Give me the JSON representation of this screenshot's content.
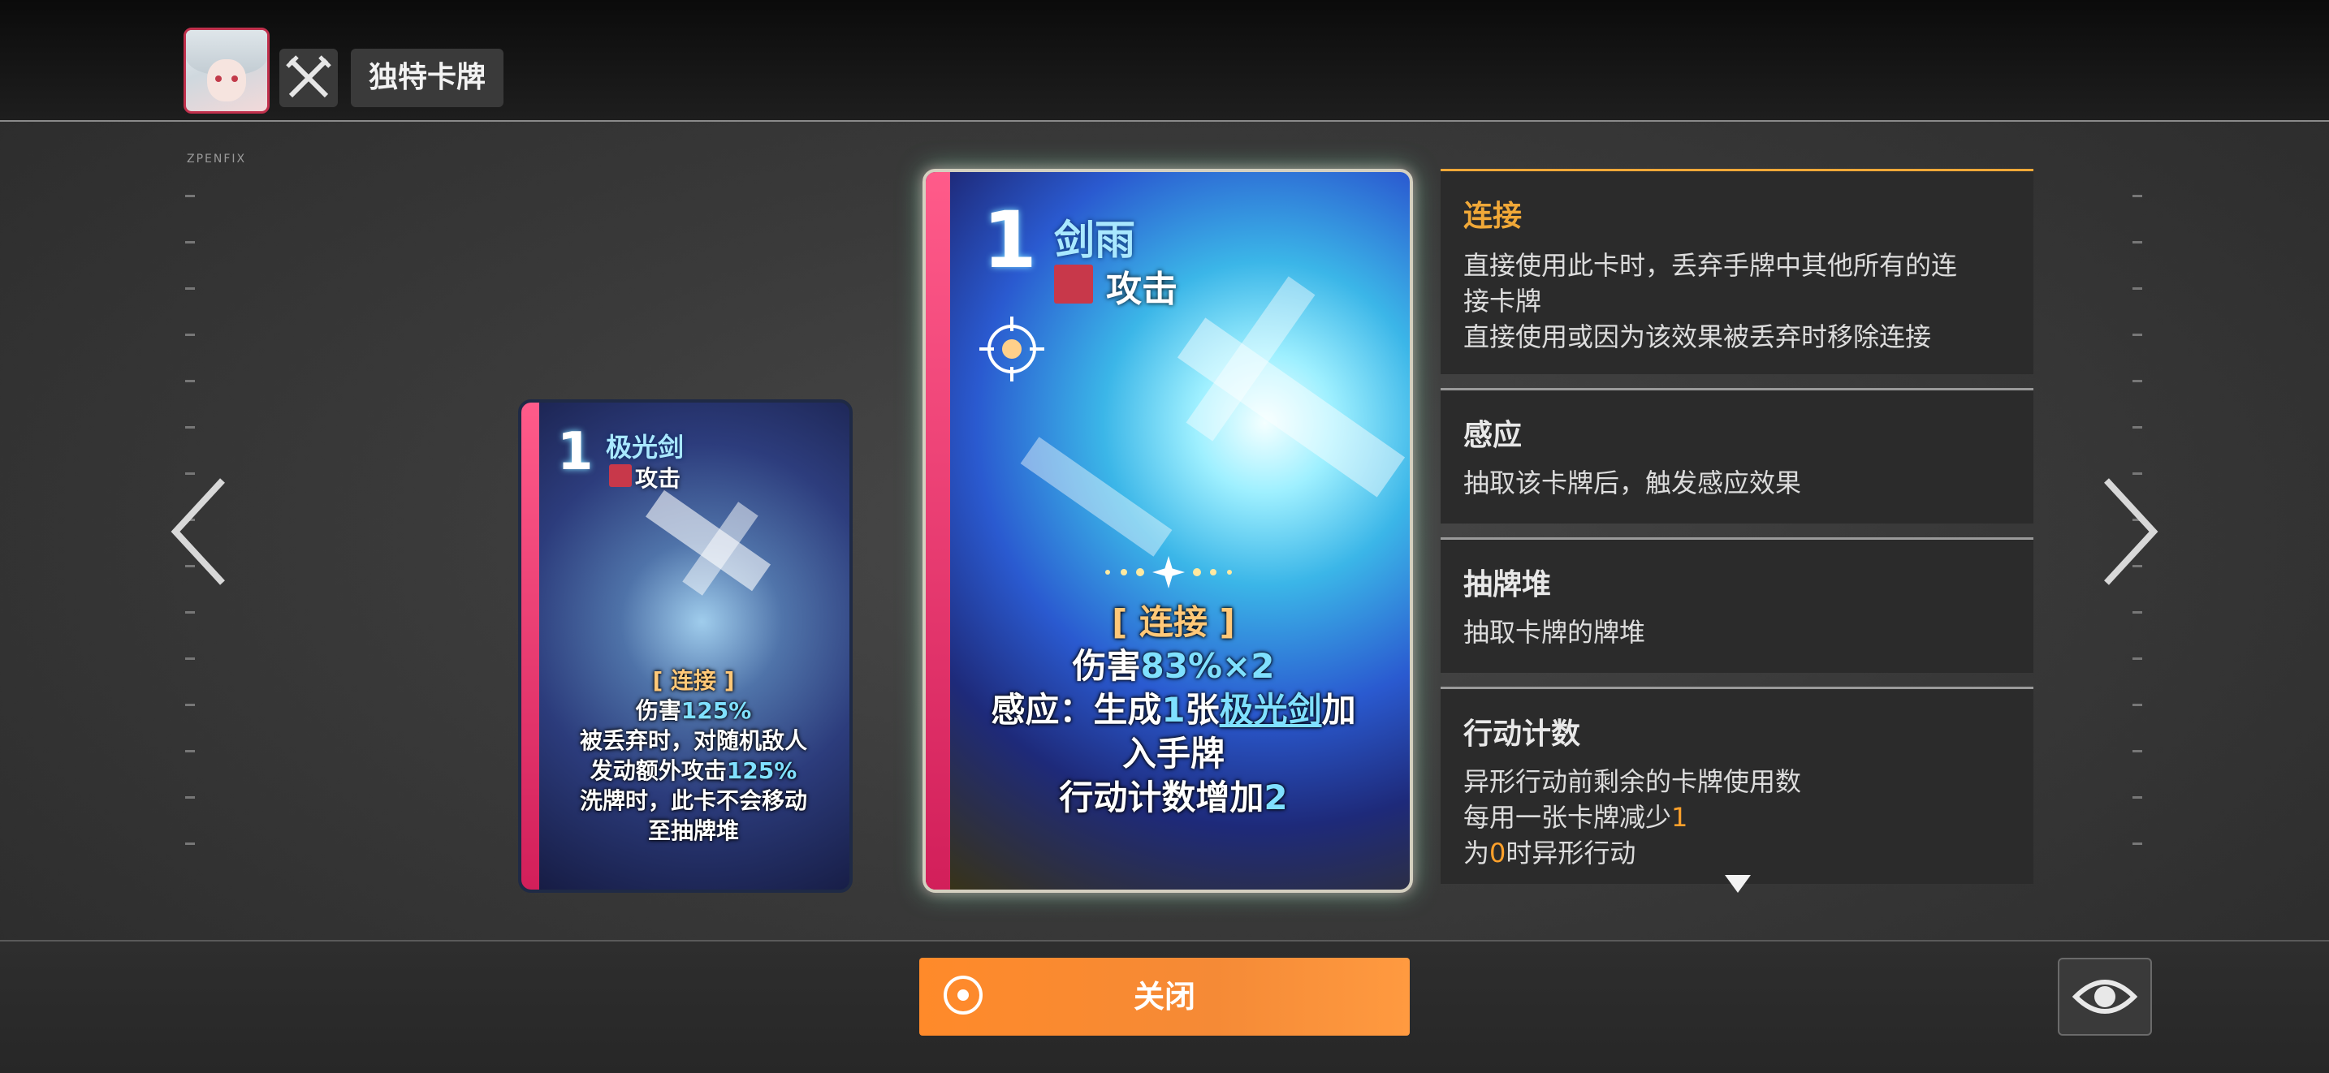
{
  "header": {
    "title": "独特卡牌",
    "avatar_icon": "character-portrait",
    "type_icon": "crossed-swords-icon",
    "tiny_label": "ZPENFIX"
  },
  "cards": {
    "small": {
      "cost": "1",
      "name": "极光剑",
      "type": "攻击",
      "tag": "[ 连接 ]",
      "line1_prefix": "伤害",
      "line1_value": "125%",
      "line2": "被丢弃时，对随机敌人",
      "line3_prefix": "发动额外攻击",
      "line3_value": "125%",
      "line4": "洗牌时，此卡不会移动",
      "line5": "至抽牌堆"
    },
    "main": {
      "cost": "1",
      "name": "剑雨",
      "type": "攻击",
      "tag": "[ 连接 ]",
      "line1_prefix": "伤害",
      "line1_value": "83%×2",
      "line2_prefix": "感应：生成",
      "line2_count": "1",
      "line2_mid": "张",
      "line2_link": "极光剑",
      "line2_suffix": "加",
      "line3": "入手牌",
      "line4_prefix": "行动计数增加",
      "line4_value": "2"
    }
  },
  "keywords": [
    {
      "title": "连接",
      "desc1": "直接使用此卡时，丢弃手牌中其他所有的连",
      "desc2": "接卡牌",
      "desc3": "直接使用或因为该效果被丢弃时移除连接"
    },
    {
      "title": "感应",
      "desc1": "抽取该卡牌后，触发感应效果"
    },
    {
      "title": "抽牌堆",
      "desc1": "抽取卡牌的牌堆"
    },
    {
      "title": "行动计数",
      "desc1": "异形行动前剩余的卡牌使用数",
      "desc2_prefix": "每用一张卡牌减少",
      "desc2_value": "1",
      "desc3_prefix": "为",
      "desc3_value": "0",
      "desc3_suffix": "时异形行动"
    }
  ],
  "footer": {
    "close_label": "关闭",
    "eye_icon": "eye-icon"
  },
  "colors": {
    "accent_orange": "#ff8a2a",
    "keyword_gold": "#f0a838",
    "highlight_cyan": "#7fe0ff",
    "card_stripe": "#e0306a"
  }
}
